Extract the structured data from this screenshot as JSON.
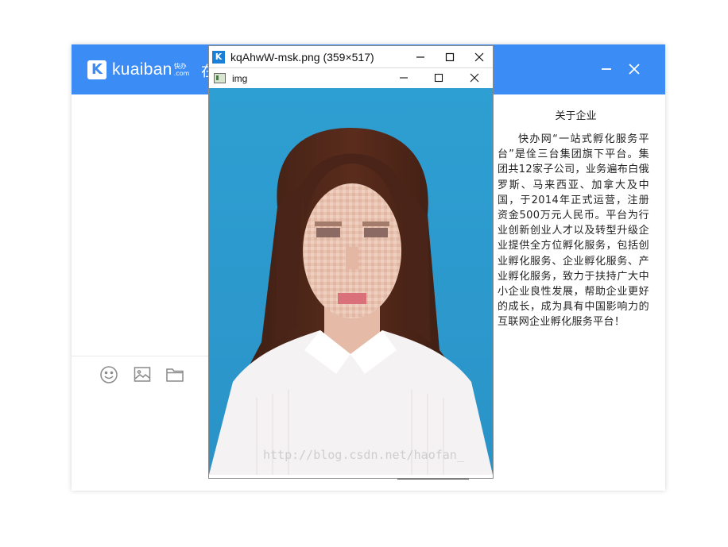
{
  "chat": {
    "brand_mark": "K",
    "brand_name": "kuaiban",
    "brand_sub_top": "快办",
    "brand_sub_bottom": ".com",
    "title_fragment": "在",
    "about_title": "关于企业",
    "about_text": "快办网“一站式孵化服务平台”是佺三台集团旗下平台。集团共12家子公司，业务遍布白俄罗斯、马来西亚、加拿大及中国，于2014年正式运营，注册资金500万元人民币。平台为行业创新创业人才以及转型升级企业提供全方位孵化服务，包括创业孵化服务、企业孵化服务、产业孵化服务，致力于扶持广大中小企业良性发展，帮助企业更好的成长，成为具有中国影响力的互联网企业孵化服务平台！",
    "icons": [
      "emoji-icon",
      "image-icon",
      "folder-icon"
    ]
  },
  "viewer": {
    "window_title": "kqAhwW-msk.png (359×517)",
    "inner_title": "img",
    "watermark": "http://blog.csdn.net/haofan_"
  },
  "colors": {
    "brand_blue": "#3c8cf5",
    "photo_background": "#2a9fd2"
  }
}
